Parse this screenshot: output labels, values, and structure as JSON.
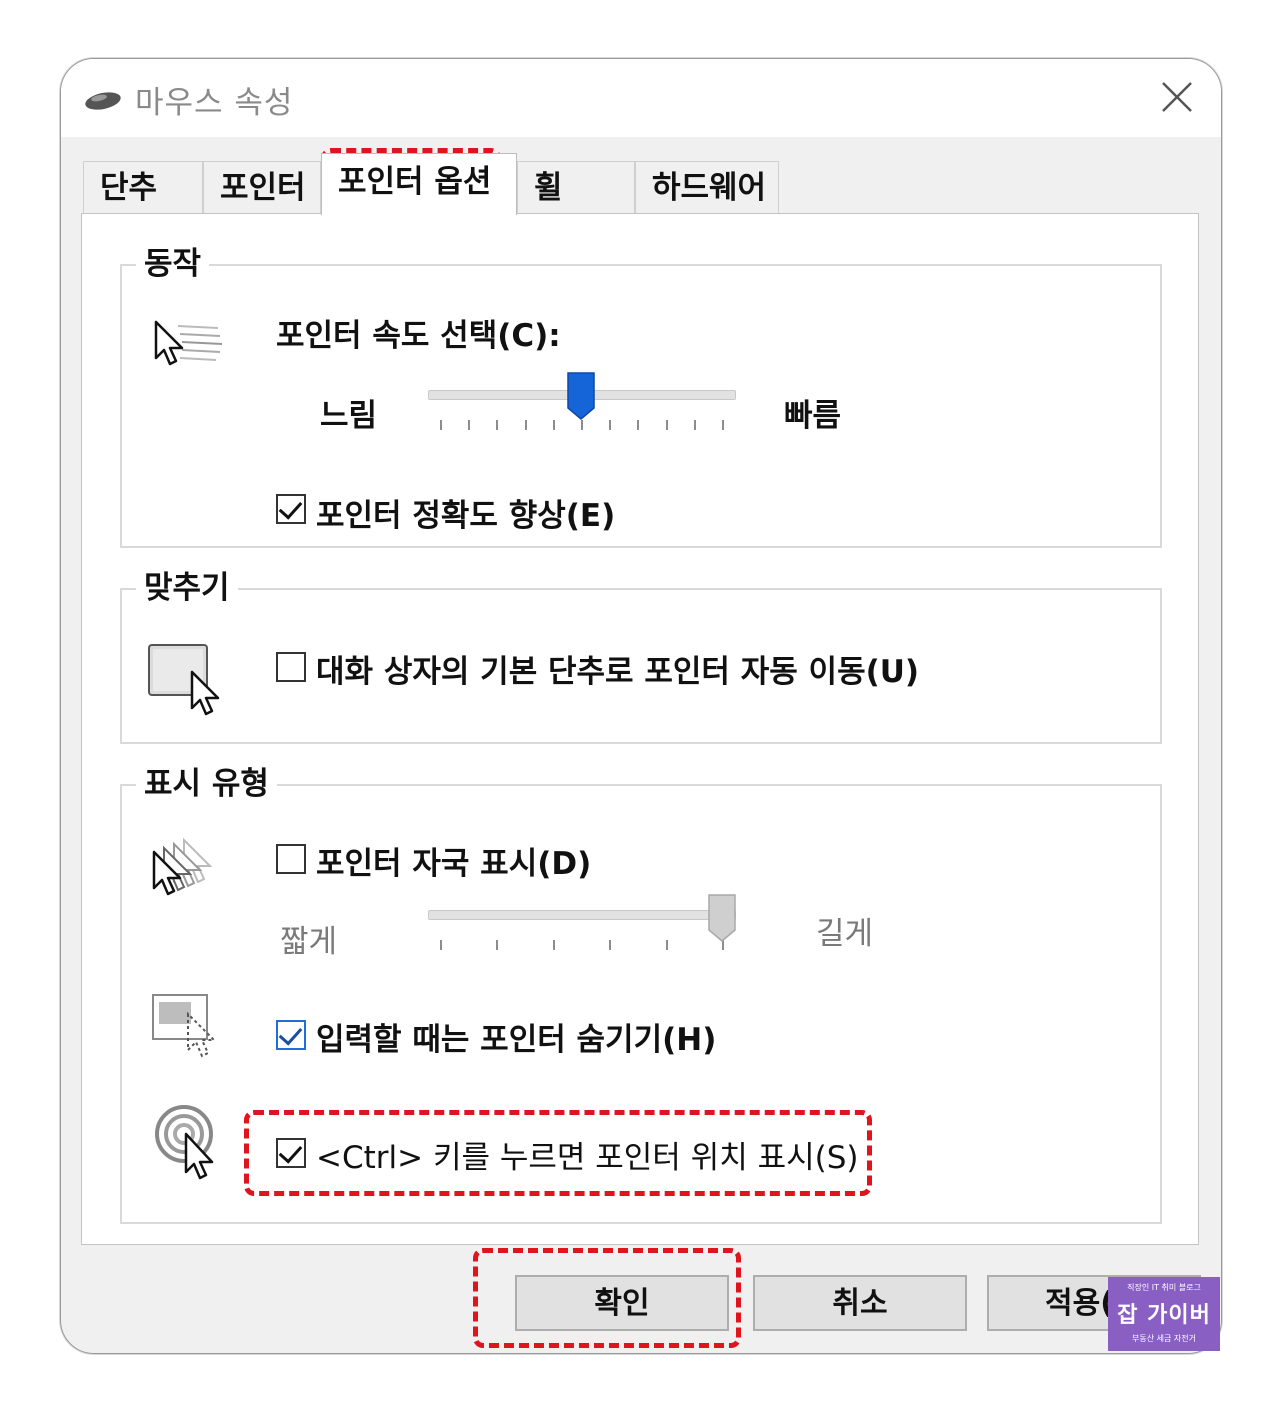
{
  "window": {
    "title": "마우스 속성"
  },
  "tabs": [
    {
      "label": "단추"
    },
    {
      "label": "포인터"
    },
    {
      "label": "포인터 옵션"
    },
    {
      "label": "휠"
    },
    {
      "label": "하드웨어"
    }
  ],
  "motion": {
    "legend": "동작",
    "speed_label": "포인터 속도 선택(C):",
    "slow_label": "느림",
    "fast_label": "빠름",
    "speed_value_fraction": 0.5,
    "precision_label": "포인터 정확도 향상(E)",
    "precision_checked": true
  },
  "snap": {
    "legend": "맞추기",
    "snap_label": "대화 상자의 기본 단추로 포인터 자동 이동(U)",
    "snap_checked": false
  },
  "visibility": {
    "legend": "표시 유형",
    "trails_label": "포인터 자국 표시(D)",
    "trails_checked": false,
    "short_label": "짧게",
    "long_label": "길게",
    "trails_value_fraction": 1.0,
    "hide_label": "입력할 때는 포인터 숨기기(H)",
    "hide_checked": true,
    "ctrl_label": "<Ctrl> 키를 누르면 포인터 위치 표시(S)",
    "ctrl_checked": true
  },
  "buttons": {
    "ok": "확인",
    "cancel": "취소",
    "apply": "적용(A)"
  },
  "watermark": {
    "top": "직장인 IT 취미 블로그",
    "mid": "잡 가이버",
    "bottom": "부동산 세금 자전거"
  },
  "colors": {
    "highlight": "#e0141c",
    "slider_thumb": "#1565d8",
    "badge": "#8a5fc4"
  }
}
